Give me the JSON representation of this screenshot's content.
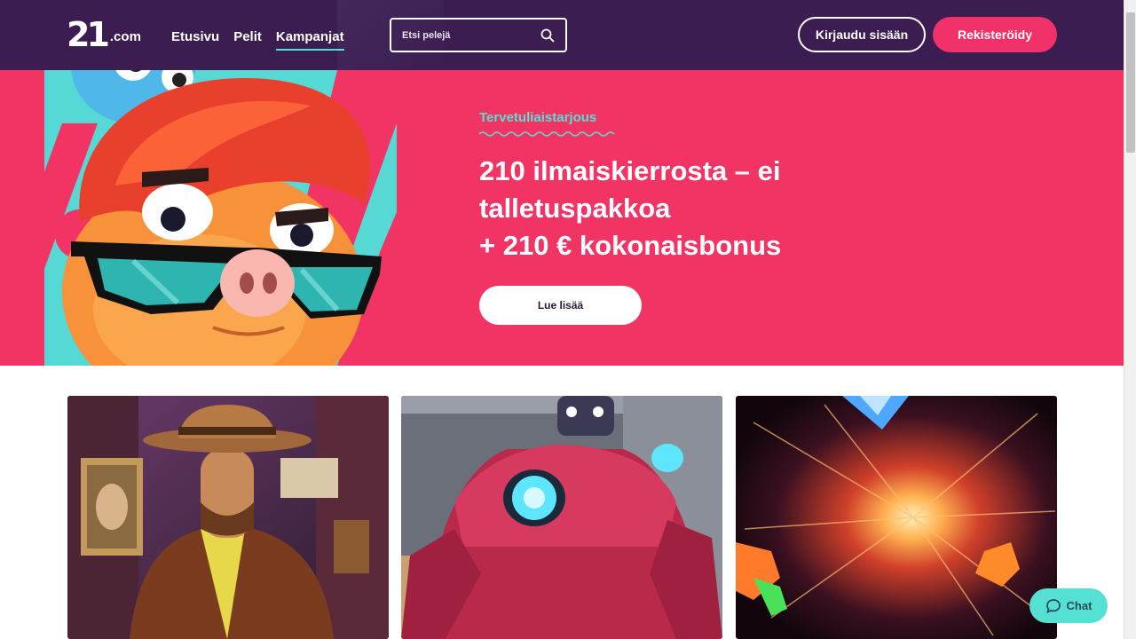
{
  "header": {
    "logo_text": "21",
    "logo_suffix": ".com",
    "nav": [
      {
        "label": "Etusivu"
      },
      {
        "label": "Pelit"
      },
      {
        "label": "Kampanjat",
        "active": true
      }
    ],
    "search": {
      "placeholder": "Etsi pelejä",
      "icon": "search-icon"
    },
    "login_label": "Kirjaudu sisään",
    "register_label": "Rekisteröidy"
  },
  "hero": {
    "label": "Tervetuliaistarjous",
    "title_lines": [
      "210 ilmaiskierrosta – ei",
      "talletuspakkoa",
      "+ 210 € kokonaisbonus"
    ],
    "cta_label": "Lue lisää"
  },
  "chat": {
    "label": "Chat",
    "icon": "chat-bubble-icon"
  },
  "colors": {
    "header_bg": "#3b1d52",
    "hero_bg": "#f23465",
    "accent_teal": "#54e0d3",
    "register_pink": "#f0316a"
  }
}
